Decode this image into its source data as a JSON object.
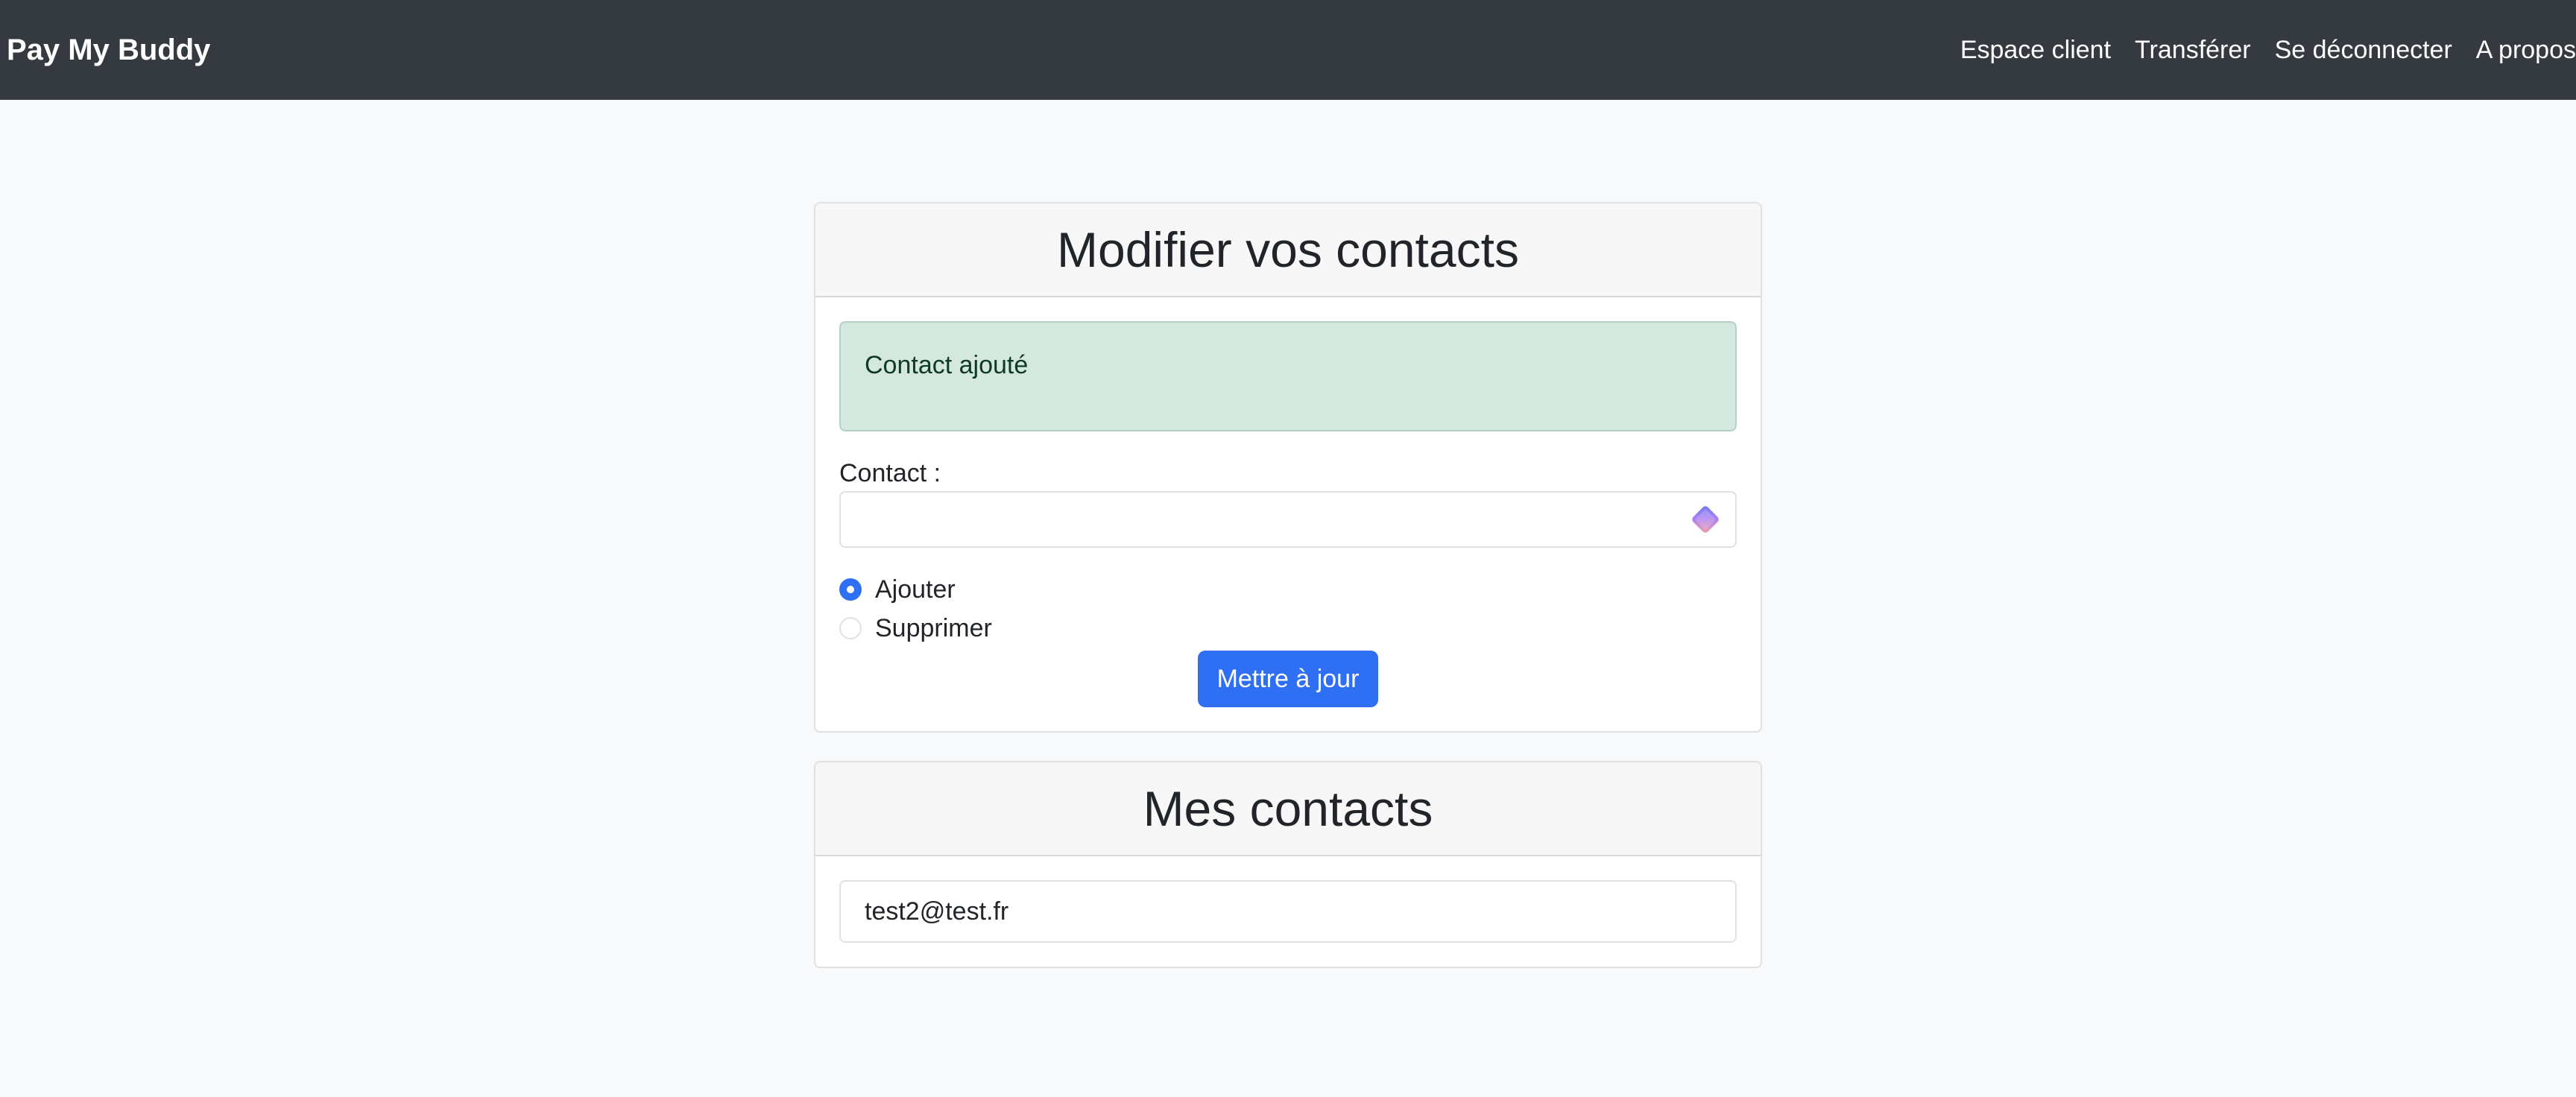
{
  "navbar": {
    "brand": "Pay My Buddy",
    "links": [
      "Espace client",
      "Transférer",
      "Se déconnecter",
      "A propos"
    ]
  },
  "edit_card": {
    "title": "Modifier vos contacts",
    "alert": "Contact ajouté",
    "contact_label": "Contact :",
    "contact_value": "",
    "extension_icon": "password-manager-icon",
    "radio_options": [
      {
        "label": "Ajouter",
        "checked": true
      },
      {
        "label": "Supprimer",
        "checked": false
      }
    ],
    "submit_label": "Mettre à jour"
  },
  "contacts_card": {
    "title": "Mes contacts",
    "contacts": [
      "test2@test.fr"
    ]
  },
  "colors": {
    "navbar_bg": "#343a40",
    "primary": "#2f6ff3",
    "alert_success_bg": "#d5e8e0",
    "page_bg": "#f8f9fa"
  }
}
